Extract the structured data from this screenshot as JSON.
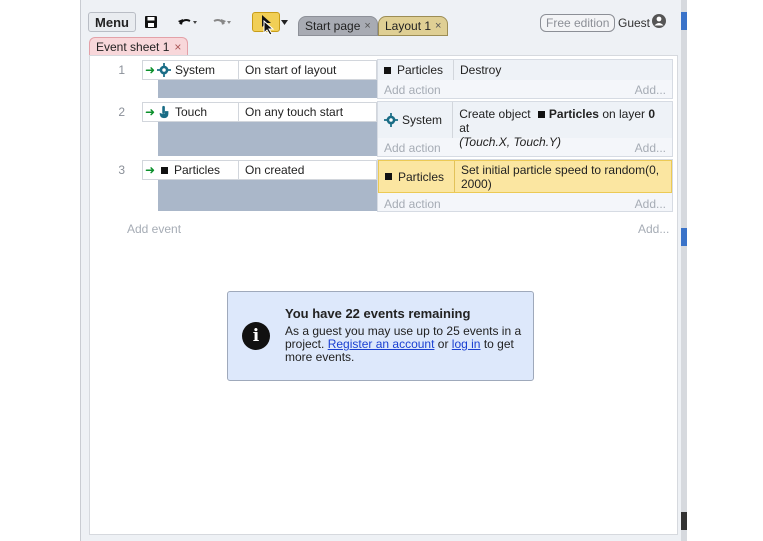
{
  "toolbar": {
    "menu_label": "Menu",
    "tabs": [
      {
        "label": "Start page",
        "close": "×"
      },
      {
        "label": "Layout 1",
        "close": "×"
      }
    ],
    "free_edition": "Free edition",
    "guest_label": "Guest"
  },
  "sheet_tab": {
    "label": "Event sheet 1",
    "close": "×"
  },
  "events": [
    {
      "number": "1",
      "condition": {
        "object": "System",
        "text": "On start of layout",
        "icon": "gear-icon"
      },
      "actions": [
        {
          "object": "Particles",
          "text": "Destroy",
          "icon": "square-icon"
        }
      ],
      "add_action": "Add action",
      "add_right": "Add..."
    },
    {
      "number": "2",
      "condition": {
        "object": "Touch",
        "text": "On any touch start",
        "icon": "touch-icon"
      },
      "actions": [
        {
          "object": "System",
          "icon": "gear-icon",
          "text_parts": {
            "prefix": "Create object",
            "object": "Particles",
            "mid": "on layer",
            "layer": "0",
            "end": "at",
            "coords": "(Touch.X, Touch.Y)"
          }
        }
      ],
      "add_action": "Add action",
      "add_right": "Add..."
    },
    {
      "number": "3",
      "condition": {
        "object": "Particles",
        "text": "On created",
        "icon": "square-icon"
      },
      "actions": [
        {
          "object": "Particles",
          "text": "Set initial particle speed to random(0, 2000)",
          "icon": "square-icon",
          "highlighted": true
        }
      ],
      "add_action": "Add action",
      "add_right": "Add..."
    }
  ],
  "add_event": "Add event",
  "add_event_right": "Add...",
  "notice": {
    "title": "You have 22 events remaining",
    "body_prefix": "As a guest you may use up to 25 events in a project.",
    "register_link": "Register an account",
    "or_text": "or",
    "login_link": "log in",
    "body_suffix": "to get more events."
  },
  "colors": {
    "accent_yellow": "#f1cf56",
    "link_blue": "#1a3fd1",
    "sheet_tab_pink": "#f8d7da"
  }
}
